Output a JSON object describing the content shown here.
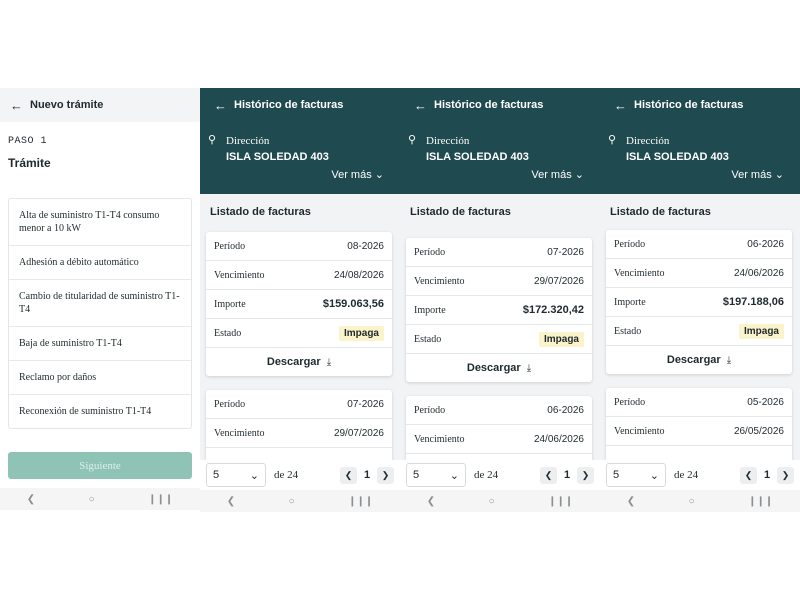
{
  "screen1": {
    "title": "Nuevo trámite",
    "step": "PASO 1",
    "section": "Trámite",
    "options": [
      "Alta de suministro T1-T4 consumo menor a 10 kW",
      "Adhesión a débito automático",
      "Cambio de titularidad de suministro T1-T4",
      "Baja de suministro T1-T4",
      "Reclamo por daños",
      "Reconexión de suministro T1-T4"
    ],
    "next_label": "Siguiente"
  },
  "screens": [
    {
      "title": "Histórico de facturas",
      "dir_label": "Dirección",
      "dir_value": "ISLA SOLEDAD 403",
      "ver_mas": "Ver más",
      "listado": "Listado de facturas",
      "card1": {
        "periodo": "08-2026",
        "vencimiento": "24/08/2026",
        "importe": "$159.063,56",
        "estado": "Impaga"
      },
      "card2": {
        "periodo": "07-2026",
        "vencimiento": "29/07/2026"
      },
      "page_size": "5",
      "de": "de 24",
      "page": "1"
    },
    {
      "title": "Histórico de facturas",
      "dir_label": "Dirección",
      "dir_value": "ISLA SOLEDAD 403",
      "ver_mas": "Ver más",
      "listado": "Listado de facturas",
      "card1": {
        "periodo": "07-2026",
        "vencimiento": "29/07/2026",
        "importe": "$172.320,42",
        "estado": "Impaga"
      },
      "card2": {
        "periodo": "06-2026",
        "vencimiento": "24/06/2026"
      },
      "page_size": "5",
      "de": "de 24",
      "page": "1"
    },
    {
      "title": "Histórico de facturas",
      "dir_label": "Dirección",
      "dir_value": "ISLA SOLEDAD 403",
      "ver_mas": "Ver más",
      "listado": "Listado de facturas",
      "card1": {
        "periodo": "06-2026",
        "vencimiento": "24/06/2026",
        "importe": "$197.188,06",
        "estado": "Impaga"
      },
      "card2": {
        "periodo": "05-2026",
        "vencimiento": "26/05/2026"
      },
      "page_size": "5",
      "de": "de 24",
      "page": "1"
    }
  ],
  "labels": {
    "periodo": "Período",
    "vencimiento": "Vencimiento",
    "importe": "Importe",
    "estado": "Estado",
    "descargar": "Descargar"
  },
  "icons": {
    "back": "arrow-left-icon",
    "location": "location-pin-icon",
    "chevron": "chevron-down-icon",
    "download": "download-icon"
  }
}
